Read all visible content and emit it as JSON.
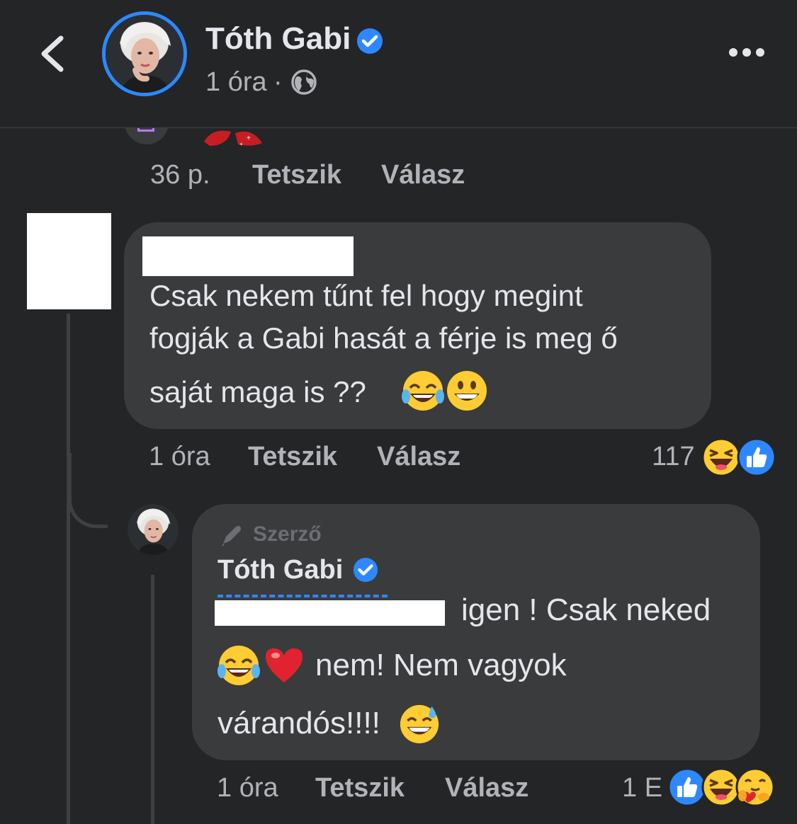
{
  "header": {
    "name": "Tóth Gabi",
    "time": "1 óra",
    "dot": "·"
  },
  "top_comment": {
    "time": "36 p.",
    "like": "Tetszik",
    "reply": "Válasz"
  },
  "comment": {
    "lines": [
      "Csak nekem tűnt fel hogy megint",
      "fogják a Gabi hasát a férje is meg ő",
      "saját maga is ??"
    ],
    "time": "1 óra",
    "like": "Tetszik",
    "reply": "Válasz",
    "reaction_count": "117"
  },
  "reply": {
    "author_badge": "Szerző",
    "name": "Tóth Gabi",
    "line1": "igen ! Csak neked",
    "line2": "nem! Nem vagyok",
    "line3": "várandós!!!!",
    "time": "1 óra",
    "like": "Tetszik",
    "reply": "Válasz",
    "reaction_count": "1 E"
  },
  "colors": {
    "background": "#242526",
    "bubble": "#3a3b3c",
    "accent_blue": "#2d88ff",
    "secondary_text": "#b0b3b8"
  }
}
